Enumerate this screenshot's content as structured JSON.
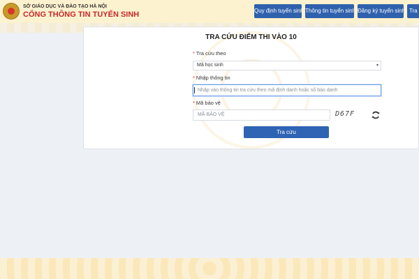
{
  "header": {
    "org_line": "SỞ GIÁO DỤC VÀ ĐÀO TẠO HÀ NỘI",
    "portal_title": "CỔNG THÔNG TIN TUYỂN SINH",
    "nav": [
      {
        "label": "Quy định tuyển sinh"
      },
      {
        "label": "Thông tin tuyển sinh"
      },
      {
        "label": "Đăng ký tuyển sinh"
      },
      {
        "label": "Tra c"
      }
    ]
  },
  "form": {
    "title": "TRA CỨU ĐIỂM THI VÀO 10",
    "lookup_by_label": "Tra cứu theo",
    "lookup_by_value": "Mã học sinh",
    "info_label": "Nhập thông tin",
    "info_placeholder": "Nhập vào thông tin tra cứu theo mã định danh hoặc số báo danh",
    "captcha_label": "Mã bảo vệ",
    "captcha_placeholder": "MÃ BẢO VỆ",
    "captcha_code": "D67F",
    "submit_label": "Tra cứu",
    "required_mark": "*"
  },
  "colors": {
    "nav_button": "#2f61ad",
    "primary": "#2f63b4",
    "brand_red": "#c6272a",
    "header_bg": "#fdf2cf"
  }
}
